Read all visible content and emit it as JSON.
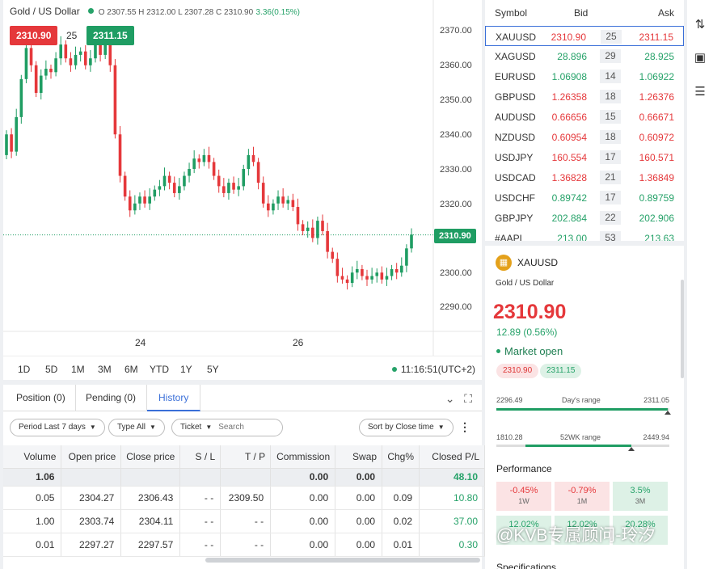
{
  "chart": {
    "symbol_title": "Gold / US Dollar",
    "ohlc": "O 2307.55  H 2312.00  L 2307.28  C 2310.90",
    "change": "3.36(0.15%)",
    "bid": "2310.90",
    "spread": "25",
    "ask": "2311.15",
    "current_price": "2310.90",
    "y_ticks": [
      "2370.00",
      "2360.00",
      "2350.00",
      "2340.00",
      "2330.00",
      "2320.00",
      "2300.00",
      "2290.00"
    ],
    "x_ticks": [
      "24",
      "26"
    ],
    "timeframes": [
      "1D",
      "5D",
      "1M",
      "3M",
      "6M",
      "YTD",
      "1Y",
      "5Y"
    ],
    "time": "11:16:51(UTC+2)",
    "colors": {
      "up": "#1f9d63",
      "down": "#e5383b"
    }
  },
  "chart_data": {
    "type": "candlestick",
    "ylim": [
      2284,
      2375
    ],
    "current_price": 2310.9,
    "close": [
      2340,
      2335,
      2345,
      2356,
      2365,
      2360,
      2352,
      2357,
      2359,
      2358,
      2362,
      2366,
      2362,
      2360,
      2363,
      2364,
      2360,
      2362,
      2366,
      2363,
      2366,
      2360,
      2340,
      2328,
      2322,
      2318,
      2320,
      2322,
      2320,
      2322,
      2324,
      2325,
      2328,
      2326,
      2323,
      2325,
      2328,
      2330,
      2333,
      2332,
      2334,
      2332,
      2328,
      2325,
      2323,
      2326,
      2324,
      2325,
      2330,
      2334,
      2332,
      2326,
      2320,
      2318,
      2320,
      2322,
      2320,
      2321,
      2319,
      2314,
      2312,
      2313,
      2310,
      2315,
      2312,
      2306,
      2304,
      2299,
      2298,
      2297,
      2300,
      2301,
      2299,
      2298,
      2299,
      2300,
      2298,
      2299,
      2301,
      2300,
      2302,
      2307,
      2311
    ]
  },
  "history": {
    "tabs": [
      "Position (0)",
      "Pending (0)",
      "History"
    ],
    "filters": {
      "period": "Period Last 7 days",
      "type": "Type All",
      "ticket": "Ticket",
      "search_placeholder": "Search",
      "sort": "Sort by Close time"
    },
    "columns": [
      "Volume",
      "Open price",
      "Close price",
      "S / L",
      "T / P",
      "Commission",
      "Swap",
      "Chg%",
      "Closed P/L"
    ],
    "summary": {
      "volume": "1.06",
      "commission": "0.00",
      "swap": "0.00",
      "pl": "48.10"
    },
    "rows": [
      [
        "0.05",
        "2304.27",
        "2306.43",
        "- -",
        "2309.50",
        "0.00",
        "0.00",
        "0.09",
        "10.80"
      ],
      [
        "1.00",
        "2303.74",
        "2304.11",
        "- -",
        "- -",
        "0.00",
        "0.00",
        "0.02",
        "37.00"
      ],
      [
        "0.01",
        "2297.27",
        "2297.57",
        "- -",
        "- -",
        "0.00",
        "0.00",
        "0.01",
        "0.30"
      ]
    ]
  },
  "symbols": {
    "headers": {
      "symbol": "Symbol",
      "bid": "Bid",
      "ask": "Ask"
    },
    "rows": [
      {
        "name": "XAUUSD",
        "bid": "2310.90",
        "spread": "25",
        "ask": "2311.15",
        "dir": "down"
      },
      {
        "name": "XAGUSD",
        "bid": "28.896",
        "spread": "29",
        "ask": "28.925",
        "dir": "up"
      },
      {
        "name": "EURUSD",
        "bid": "1.06908",
        "spread": "14",
        "ask": "1.06922",
        "dir": "up"
      },
      {
        "name": "GBPUSD",
        "bid": "1.26358",
        "spread": "18",
        "ask": "1.26376",
        "dir": "down"
      },
      {
        "name": "AUDUSD",
        "bid": "0.66656",
        "spread": "15",
        "ask": "0.66671",
        "dir": "down"
      },
      {
        "name": "NZDUSD",
        "bid": "0.60954",
        "spread": "18",
        "ask": "0.60972",
        "dir": "down"
      },
      {
        "name": "USDJPY",
        "bid": "160.554",
        "spread": "17",
        "ask": "160.571",
        "dir": "down"
      },
      {
        "name": "USDCAD",
        "bid": "1.36828",
        "spread": "21",
        "ask": "1.36849",
        "dir": "down"
      },
      {
        "name": "USDCHF",
        "bid": "0.89742",
        "spread": "17",
        "ask": "0.89759",
        "dir": "up"
      },
      {
        "name": "GBPJPY",
        "bid": "202.884",
        "spread": "22",
        "ask": "202.906",
        "dir": "up"
      },
      {
        "name": "#AAPL",
        "bid": "213.00",
        "spread": "53",
        "ask": "213.63",
        "dir": "up"
      }
    ]
  },
  "detail": {
    "symbol": "XAUUSD",
    "description": "Gold / US Dollar",
    "price": "2310.90",
    "change": "12.89 (0.56%)",
    "status": "Market open",
    "bid_chip": "2310.90",
    "ask_chip": "2311.15",
    "day_range": {
      "label": "Day's range",
      "low": "2296.49",
      "high": "2311.05",
      "position": 0.99
    },
    "wk52_range": {
      "label": "52WK range",
      "low": "1810.28",
      "high": "2449.94",
      "position": 0.78
    },
    "performance_title": "Performance",
    "performance": [
      {
        "value": "-0.45%",
        "period": "1W",
        "dir": "neg"
      },
      {
        "value": "-0.79%",
        "period": "1M",
        "dir": "neg"
      },
      {
        "value": "3.5%",
        "period": "3M",
        "dir": "pos"
      },
      {
        "value": "12.02%",
        "period": "",
        "dir": "pos"
      },
      {
        "value": "12.02%",
        "period": "",
        "dir": "pos"
      },
      {
        "value": "20.28%",
        "period": "",
        "dir": "pos"
      }
    ],
    "specs_title": "Specifications"
  },
  "watermark": "@KVB专属顾问-玲汐"
}
